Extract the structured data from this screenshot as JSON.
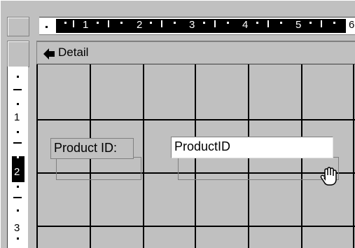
{
  "ruler": {
    "horizontal_numbers": [
      "1",
      "2",
      "3",
      "4",
      "5",
      "6"
    ],
    "vertical_numbers": [
      "1",
      "2",
      "3"
    ]
  },
  "section": {
    "label": "Detail",
    "icon": "section-arrow-icon"
  },
  "controls": {
    "label_text": "Product ID:",
    "textbox_value": "ProductID"
  },
  "cursor": {
    "icon": "hand-cursor-icon"
  },
  "colors": {
    "surface": "#c0c0c0",
    "grid_line": "#000000",
    "textbox_bg": "#ffffff"
  }
}
